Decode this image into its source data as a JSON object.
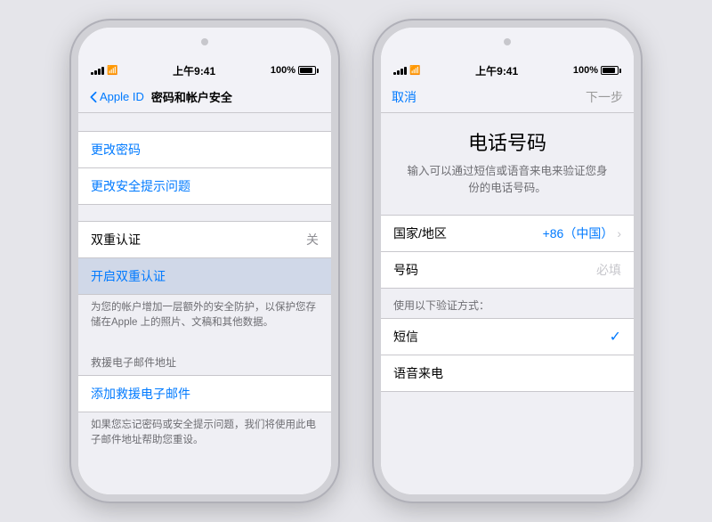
{
  "phone1": {
    "status": {
      "signal": "●●●",
      "wifi": "WiFi",
      "time": "上午9:41",
      "battery": "100%"
    },
    "nav": {
      "back_label": "Apple ID",
      "title": "密码和帐户安全"
    },
    "sections": [
      {
        "items": [
          {
            "text": "更改密码",
            "type": "link"
          },
          {
            "text": "更改安全提示问题",
            "type": "link"
          }
        ]
      },
      {
        "header": "",
        "double_auth_label": "双重认证",
        "double_auth_value": "关",
        "items": [
          {
            "text": "开启双重认证",
            "type": "link",
            "highlighted": true
          }
        ],
        "desc1": "为您的帐户增加一层额外的安全防护，以保护您存储在Apple 上的照片、文稿和其他数据。"
      }
    ],
    "rescue_email": {
      "header": "救援电子邮件地址",
      "link": "添加救援电子邮件",
      "desc": "如果您忘记密码或安全提示问题，我们将使用此电子邮件地址帮助您重设。"
    }
  },
  "phone2": {
    "status": {
      "time": "上午9:41",
      "battery": "100%"
    },
    "nav": {
      "cancel": "取消",
      "next": "下一步"
    },
    "title": "电话号码",
    "desc": "输入可以通过短信或语音来电来验证您身份的电话号码。",
    "fields": [
      {
        "label": "国家/地区",
        "value": "+86（中国）",
        "type": "link",
        "has_chevron": true
      },
      {
        "label": "号码",
        "placeholder": "必填",
        "type": "input"
      }
    ],
    "verify_section": "使用以下验证方式：",
    "verify_methods": [
      {
        "label": "短信",
        "checked": true
      },
      {
        "label": "语音来电",
        "checked": false
      }
    ]
  }
}
